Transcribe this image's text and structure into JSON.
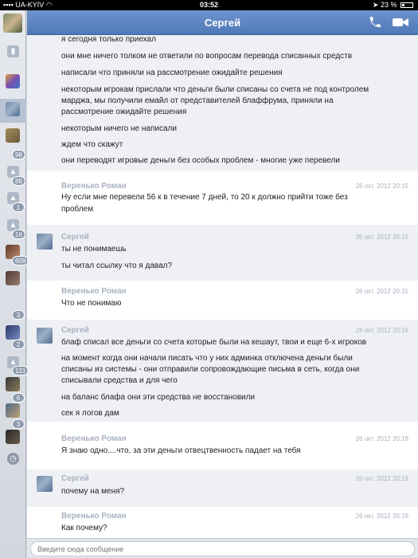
{
  "statusbar": {
    "carrier": "UA-KYIV",
    "time": "03:52",
    "battery": "23 %"
  },
  "sidebar": {
    "badges": [
      "98",
      "86",
      "1",
      "16",
      "609",
      "3",
      "2",
      "121",
      "6",
      "3"
    ]
  },
  "header": {
    "title": "Сергей"
  },
  "messages": [
    {
      "author": "",
      "date": "",
      "lines": [
        "я сегодня только приехал",
        "они мне ничего толком не ответили по вопросам перевода списанных средств",
        "написали что приняли на рассмотрение ожидайте решения",
        "некоторым игрокам прислали что деньги были списаны со счета не под контролем",
        "марджа, мы получили емайл от представителей блаффрума, приняли на",
        "рассмотрение ожидайте решения",
        "некоторым ничего не написали",
        "ждем что скажут",
        "они переводят игровые деньги без особых проблем - многие уже перевели"
      ]
    },
    {
      "author": "Веренько Роман",
      "date": "26 окт. 2012 20:15",
      "lines": [
        "Ну если мне перевели 56 к в течение 7 дней, то 20 к должно прийти тоже без",
        "проблем"
      ]
    },
    {
      "author": "Сергей",
      "date": "26 окт. 2012 20:15",
      "lines": [
        "ты не понимаешь",
        "ты читал ссылку что я давал?"
      ]
    },
    {
      "author": "Веренько Роман",
      "date": "26 окт. 2012 20:15",
      "lines": [
        "Что не понимаю"
      ]
    },
    {
      "author": "Сергей",
      "date": "26 окт. 2012 20:16",
      "lines": [
        "блаф списал все деньги со счета которые были на кешаут, твои и еще 6-х игроков",
        "на момент когда они начали писать что у них админка отключена деньги были",
        "списаны из системы - они отправили сопровождающие письма в сеть, когда они",
        "списывали средства и для чего",
        "на баланс блафа они эти средства не восстановили",
        "сек я логов дам"
      ]
    },
    {
      "author": "Веренько Роман",
      "date": "26 окт. 2012 20:18",
      "lines": [
        "Я знаю одно....что, за эти деньги отвецтвенность падает на тебя"
      ]
    },
    {
      "author": "Сергей",
      "date": "26 окт. 2012 20:19",
      "lines": [
        "почему на меня?"
      ]
    },
    {
      "author": "Веренько Роман",
      "date": "26 окт. 2012 20:19",
      "lines": [
        "Как почему?"
      ]
    }
  ],
  "input": {
    "placeholder": "Введите сюда сообщение"
  },
  "colors": {
    "header": "#5b82bf",
    "author": "#a9b2bf",
    "alt_row": "#eef0f4"
  },
  "icons": [
    "signal-icon",
    "wifi-icon",
    "location-icon",
    "battery-icon",
    "phone-icon",
    "video-call-icon",
    "contacts-icon",
    "clock-icon"
  ]
}
